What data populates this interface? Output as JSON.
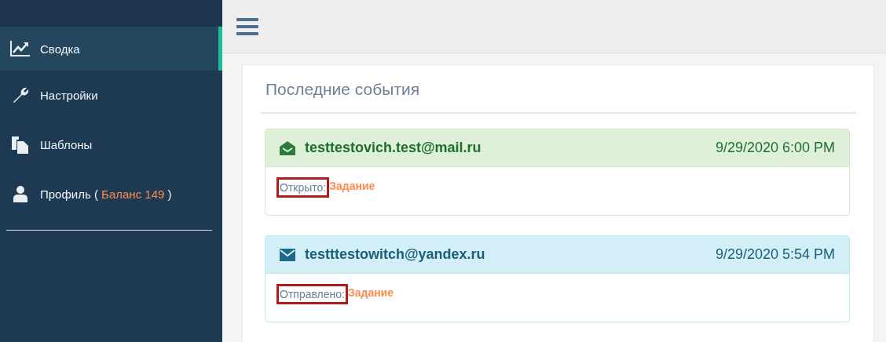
{
  "sidebar": {
    "items": [
      {
        "kind": "chart",
        "label": "Сводка",
        "selected": true
      },
      {
        "kind": "wrench",
        "label": "Настройки",
        "selected": false
      },
      {
        "kind": "copy",
        "label": "Шаблоны",
        "selected": false
      },
      {
        "kind": "user",
        "label": "Профиль (",
        "balance": "Баланс 149",
        "suffix": ")",
        "selected": false
      }
    ]
  },
  "panel": {
    "title": "Последние события",
    "events": [
      {
        "kind": "opened",
        "email": "testtestovich.test@mail.ru",
        "time": "9/29/2020 6:00 PM",
        "status": "Открыто:",
        "highlighted": true,
        "link": "Задание"
      },
      {
        "kind": "sent",
        "email": "testttestowitch@yandex.ru",
        "time": "9/29/2020 5:54 PM",
        "status": "Отправлено:",
        "highlighted": true,
        "link": "Задание"
      }
    ]
  }
}
